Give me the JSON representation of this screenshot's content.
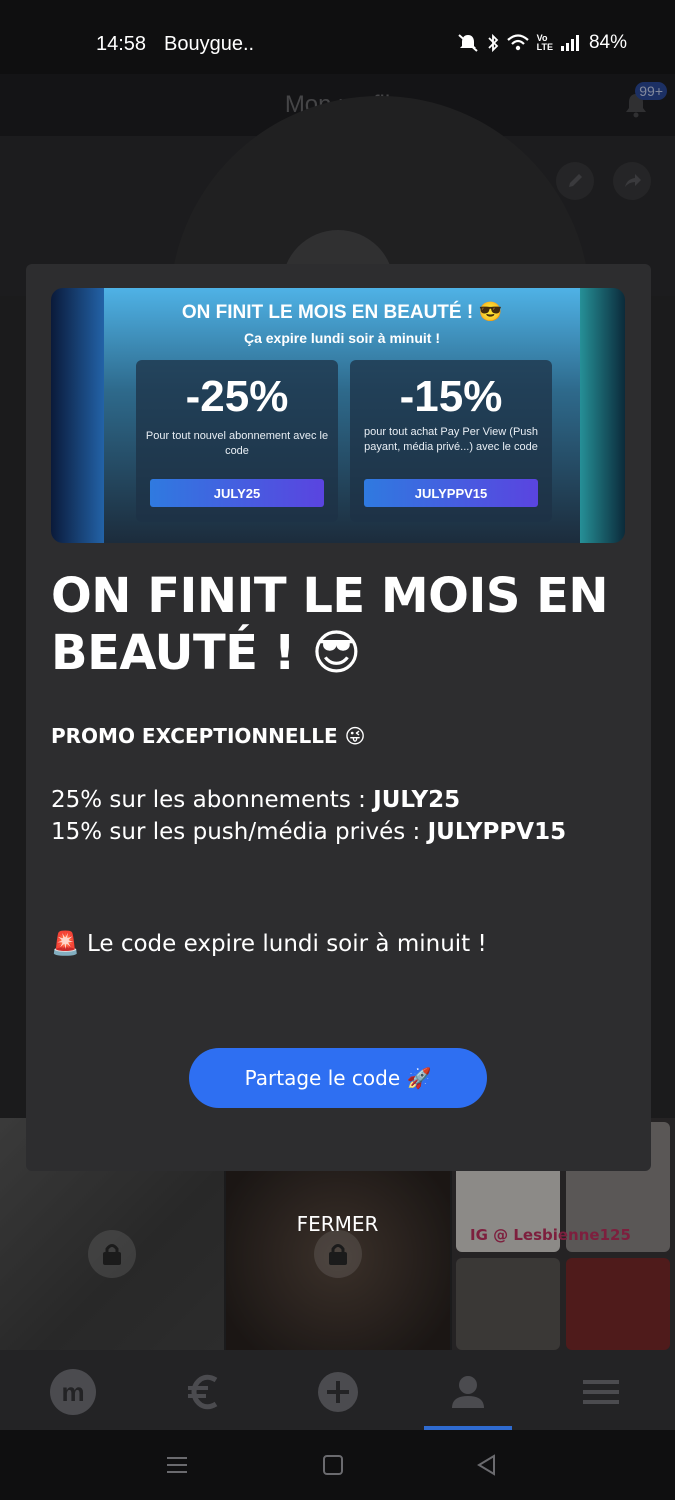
{
  "status_bar": {
    "time": "14:58",
    "carrier": "Bouygue..",
    "battery": "84%"
  },
  "header": {
    "title": "Mon profil",
    "notification_count": "99+"
  },
  "modal": {
    "banner": {
      "title": "ON FINIT LE MOIS EN BEAUTÉ ! 😎",
      "subtitle": "Ça expire lundi soir à minuit !",
      "cards": [
        {
          "percent": "-25%",
          "description": "Pour tout nouvel abonnement avec le code",
          "code": "JULY25"
        },
        {
          "percent": "-15%",
          "description": "pour tout achat Pay Per View (Push payant, média privé...) avec le code",
          "code": "JULYPPV15"
        }
      ]
    },
    "headline": "ON FINIT LE MOIS EN BEAUTÉ ! 😎",
    "promo_label": "PROMO EXCEPTIONNELLE 😜",
    "line1_text": "25% sur les abonnements : ",
    "line1_code": "JULY25",
    "line2_text": "15% sur les push/média privés : ",
    "line2_code": "JULYPPV15",
    "expire_text": "🚨 Le code expire lundi soir à minuit !",
    "share_button": "Partage le code 🚀",
    "close_label": "FERMER"
  },
  "grid": {
    "watermark": "IG @ Lesbienne125"
  },
  "bottom_nav": {
    "items": [
      "home-logo",
      "euro-icon",
      "add-icon",
      "profile-icon",
      "menu-icon"
    ],
    "home_letter": "m",
    "active": "profile-icon",
    "active_color": "#2f6bd0"
  },
  "accent_color": "#2e6ff2"
}
